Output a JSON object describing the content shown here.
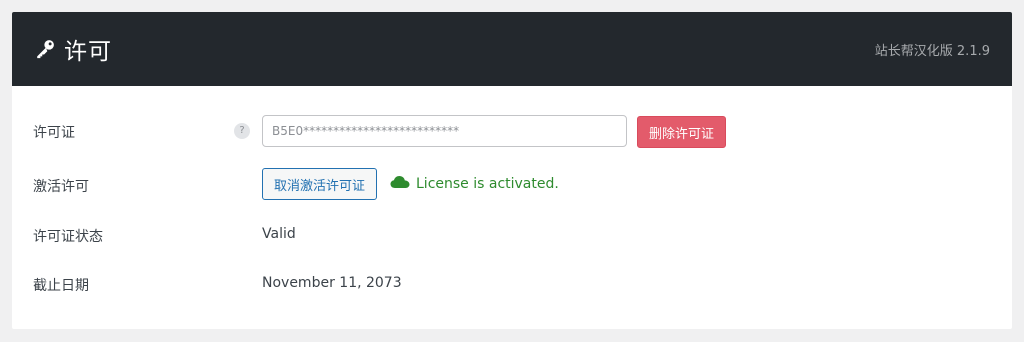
{
  "header": {
    "title": "许可",
    "version": "站长帮汉化版 2.1.9",
    "icon": "key-icon"
  },
  "rows": {
    "license": {
      "label": "许可证",
      "help": "?",
      "input_value": "B5E0**************************",
      "delete_button": "删除许可证"
    },
    "activation": {
      "label": "激活许可",
      "deactivate_button": "取消激活许可证",
      "status_icon": "cloud-icon",
      "status_text": "License is activated.",
      "status_color": "#2e8b2e"
    },
    "status": {
      "label": "许可证状态",
      "value": "Valid"
    },
    "expiry": {
      "label": "截止日期",
      "value": "November 11, 2073"
    }
  },
  "colors": {
    "header_bg": "#23282d",
    "delete_button_bg": "#e35b6b",
    "accent_blue": "#2271b1"
  }
}
